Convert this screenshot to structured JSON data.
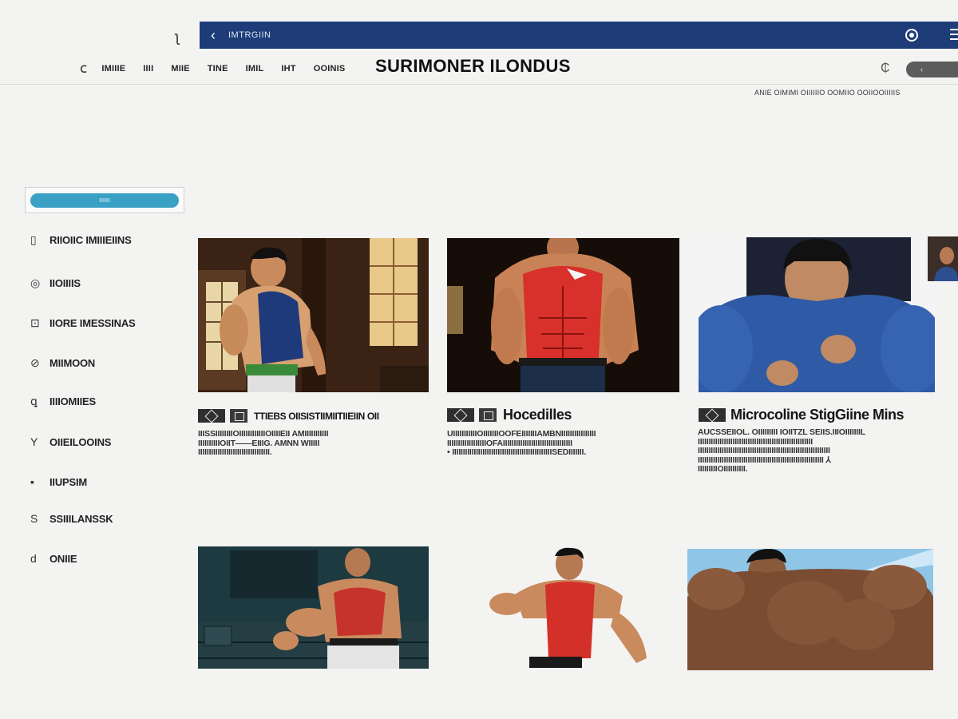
{
  "browser": {
    "corner_glyph": "ʅ",
    "back_icon": "chevron-left-icon",
    "url": "IMTRGIIN",
    "target_icon": "target-icon",
    "menu_icon": "menu-icon"
  },
  "nav": {
    "swirl_glyph": "ⅽ",
    "items": [
      "IMIIIE",
      "IIII",
      "MIIE",
      "TINE",
      "IMIL",
      "IHT",
      "OOINIS"
    ],
    "site_title": "SURIMONER ILONDUS",
    "right_glyph": "₵",
    "pill_label": "‹",
    "subline": "ANIE OIMIMI OIIIIIIO OOMIIO OOIIOOIIIIIS"
  },
  "sidebar": {
    "search_value": "IIIIIII",
    "items": [
      {
        "icon": "▯",
        "label": "RIIOIIC IMIIIEIINS"
      },
      {
        "icon": "◎",
        "label": "IIOIIIIS"
      },
      {
        "icon": "⊡",
        "label": "IIORE IMESSINAS"
      },
      {
        "icon": "⊘",
        "label": "MIIMOON"
      },
      {
        "icon": "ꝗ",
        "label": "IIIIOMIIES"
      },
      {
        "icon": "Y",
        "label": "OIIEILOOINS"
      },
      {
        "icon": "▪",
        "label": "IIUPSIM"
      },
      {
        "icon": "S",
        "label": "SSIIILANSSK"
      },
      {
        "icon": "d",
        "label": "ONIIE"
      }
    ]
  },
  "cards": [
    {
      "title": "TTIEBS OIISISTIIMIITIIEIIN OII",
      "desc": [
        "IIISSIIIIIIIIOIIIIIIIIIIIIOIIIIEII AMIIIIIIIIIII",
        "IIIIIIIIIIOIIT——EIIIG. AMNN WIIIII",
        "IIIIIIIIIIIIIIIIIIIIIIIIIIIIIIIII."
      ]
    },
    {
      "title": "Hocedilles",
      "desc": [
        "UIIIIIIIIIIIOIIIIIIIOOFEIIIIIIIAMBNIIIIIIIIIIIIIIII",
        "IIIIIIIIIIIIIIIIIIOFAIIIIIIIIIIIIIIIIIIIIIIIIIIIIIIII",
        "• IIIIIIIIIIIIIIIIIIIIIIIIIIIIIIIIIIIIIIIIIIIIIISEDIIIIIII."
      ]
    },
    {
      "title": "Microcoline StigGiine Mins",
      "desc": [
        "AUCSSEIIOL. OIIIIIIIII IOIITZL SEIIS.IIIOIIIIIIIL",
        "IIIIIIIIIIIIIIIIIIIIIIIIIIIIIIIIIIIIIIIIIIIIIIIIIIIII",
        "IIIIIIIIIIIIIIIIIIIIIIIIIIIIIIIIIIIIIIIIIIIIIIIIIIIIIIIIIIIII",
        "IIIIIIIIIIIIIIIIIIIIIIIIIIIIIIIIIIIIIIIIIIIIIIIIIIIIIIIIII ⅄",
        "IIIIIIIIIOIIIIIIIIII."
      ]
    }
  ]
}
